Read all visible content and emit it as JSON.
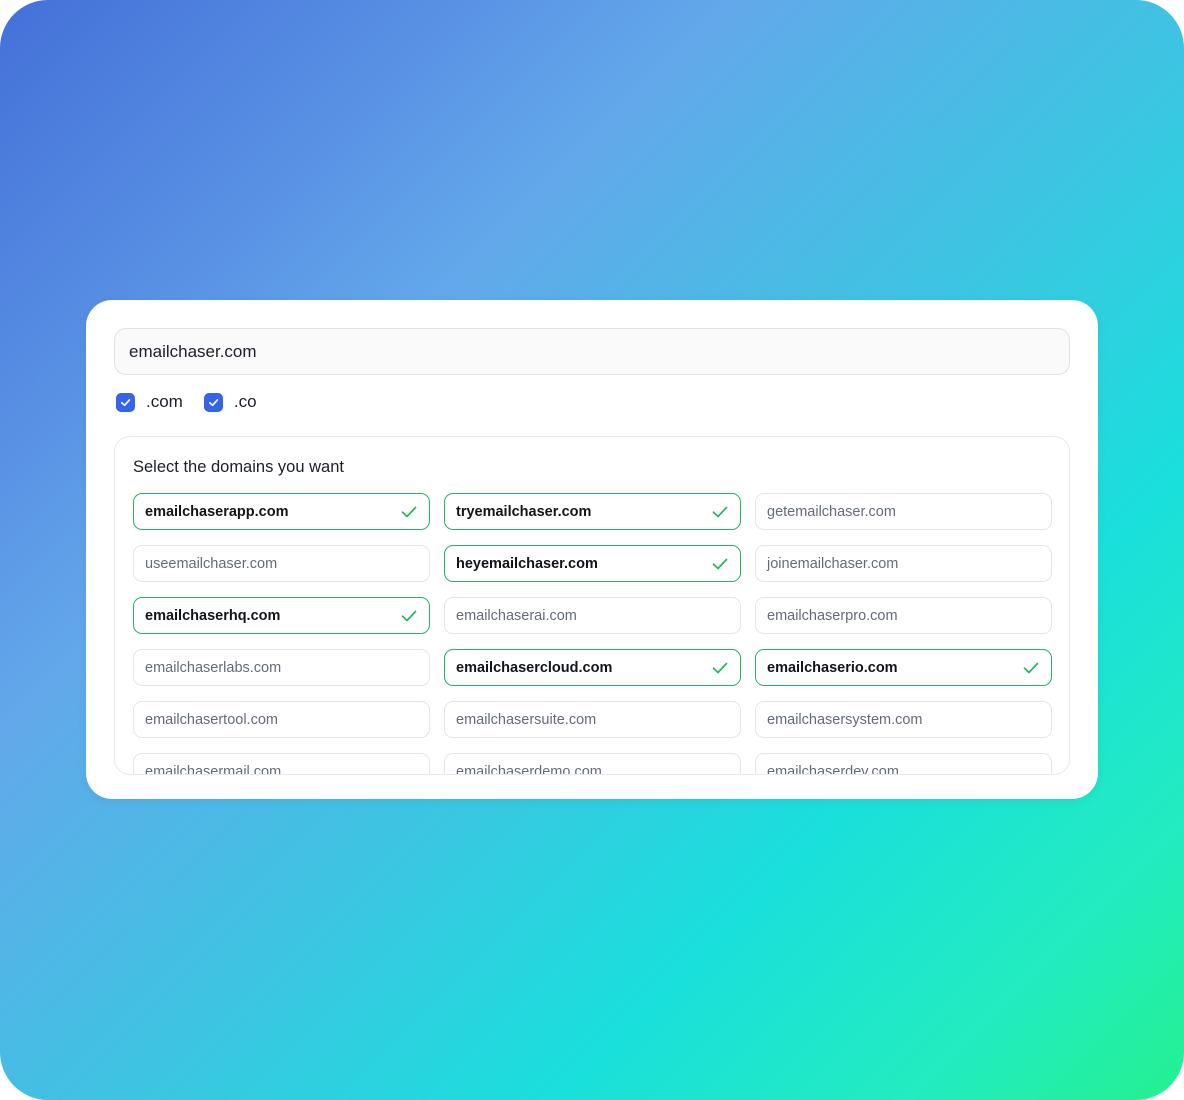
{
  "search": {
    "value": "emailchaser.com"
  },
  "tlds": [
    {
      "label": ".com",
      "checked": true
    },
    {
      "label": ".co",
      "checked": true
    }
  ],
  "domains_panel": {
    "title": "Select the domains you want",
    "items": [
      {
        "label": "emailchaserapp.com",
        "selected": true
      },
      {
        "label": "tryemailchaser.com",
        "selected": true
      },
      {
        "label": "getemailchaser.com",
        "selected": false
      },
      {
        "label": "useemailchaser.com",
        "selected": false
      },
      {
        "label": "heyemailchaser.com",
        "selected": true
      },
      {
        "label": "joinemailchaser.com",
        "selected": false
      },
      {
        "label": "emailchaserhq.com",
        "selected": true
      },
      {
        "label": "emailchaserai.com",
        "selected": false
      },
      {
        "label": "emailchaserpro.com",
        "selected": false
      },
      {
        "label": "emailchaserlabs.com",
        "selected": false
      },
      {
        "label": "emailchasercloud.com",
        "selected": true
      },
      {
        "label": "emailchaserio.com",
        "selected": true
      },
      {
        "label": "emailchasertool.com",
        "selected": false
      },
      {
        "label": "emailchasersuite.com",
        "selected": false
      },
      {
        "label": "emailchasersystem.com",
        "selected": false
      },
      {
        "label": "emailchasermail.com",
        "selected": false
      },
      {
        "label": "emailchaserdemo.com",
        "selected": false
      },
      {
        "label": "emailchaserdev.com",
        "selected": false
      }
    ]
  },
  "colors": {
    "checkbox": "#3563e9",
    "selected_border": "#26b563",
    "check_mark": "#26b563"
  }
}
